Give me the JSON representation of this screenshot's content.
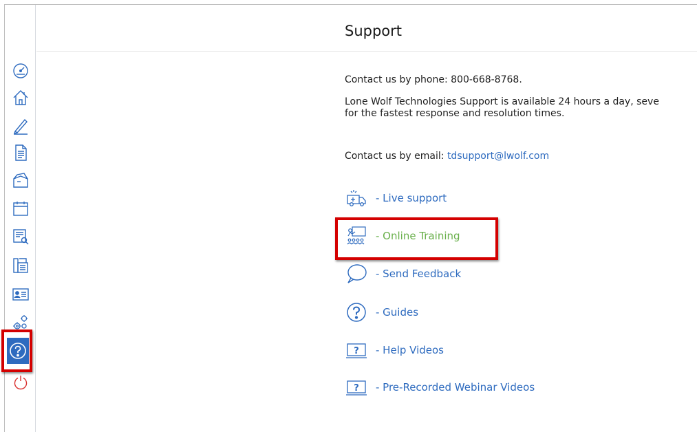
{
  "page": {
    "title": "Support"
  },
  "contact": {
    "phone_text": "Contact us by phone: 800-668-8768.",
    "availability_line1": "Lone Wolf Technologies Support is available 24 hours a day, seve",
    "availability_line2": "for the fastest response and resolution times.",
    "email_prefix": "Contact us by email: ",
    "email": "tdsupport@lwolf.com"
  },
  "links": [
    {
      "label": "- Live support",
      "icon": "ambulance-icon"
    },
    {
      "label": "- Online Training",
      "icon": "training-class-icon"
    },
    {
      "label": "- Send Feedback",
      "icon": "speech-bubble-icon"
    },
    {
      "label": "- Guides",
      "icon": "question-circle-icon"
    },
    {
      "label": "- Help Videos",
      "icon": "video-screen-icon"
    },
    {
      "label": "- Pre-Recorded Webinar Videos",
      "icon": "video-screen-icon"
    }
  ],
  "sidebar": {
    "icons": [
      "dashboard-icon",
      "home-icon",
      "pen-icon",
      "document-icon",
      "box-icon",
      "calendar-icon",
      "report-search-icon",
      "fax-icon",
      "contact-card-icon",
      "settings-gears-icon",
      "help-icon",
      "power-icon"
    ],
    "active": "help-icon"
  },
  "colors": {
    "link": "#2e6bbf",
    "highlight_link": "#6ab04c",
    "active_bg": "#2e6bbf",
    "annotation": "#d40000",
    "power": "#d9302f"
  }
}
